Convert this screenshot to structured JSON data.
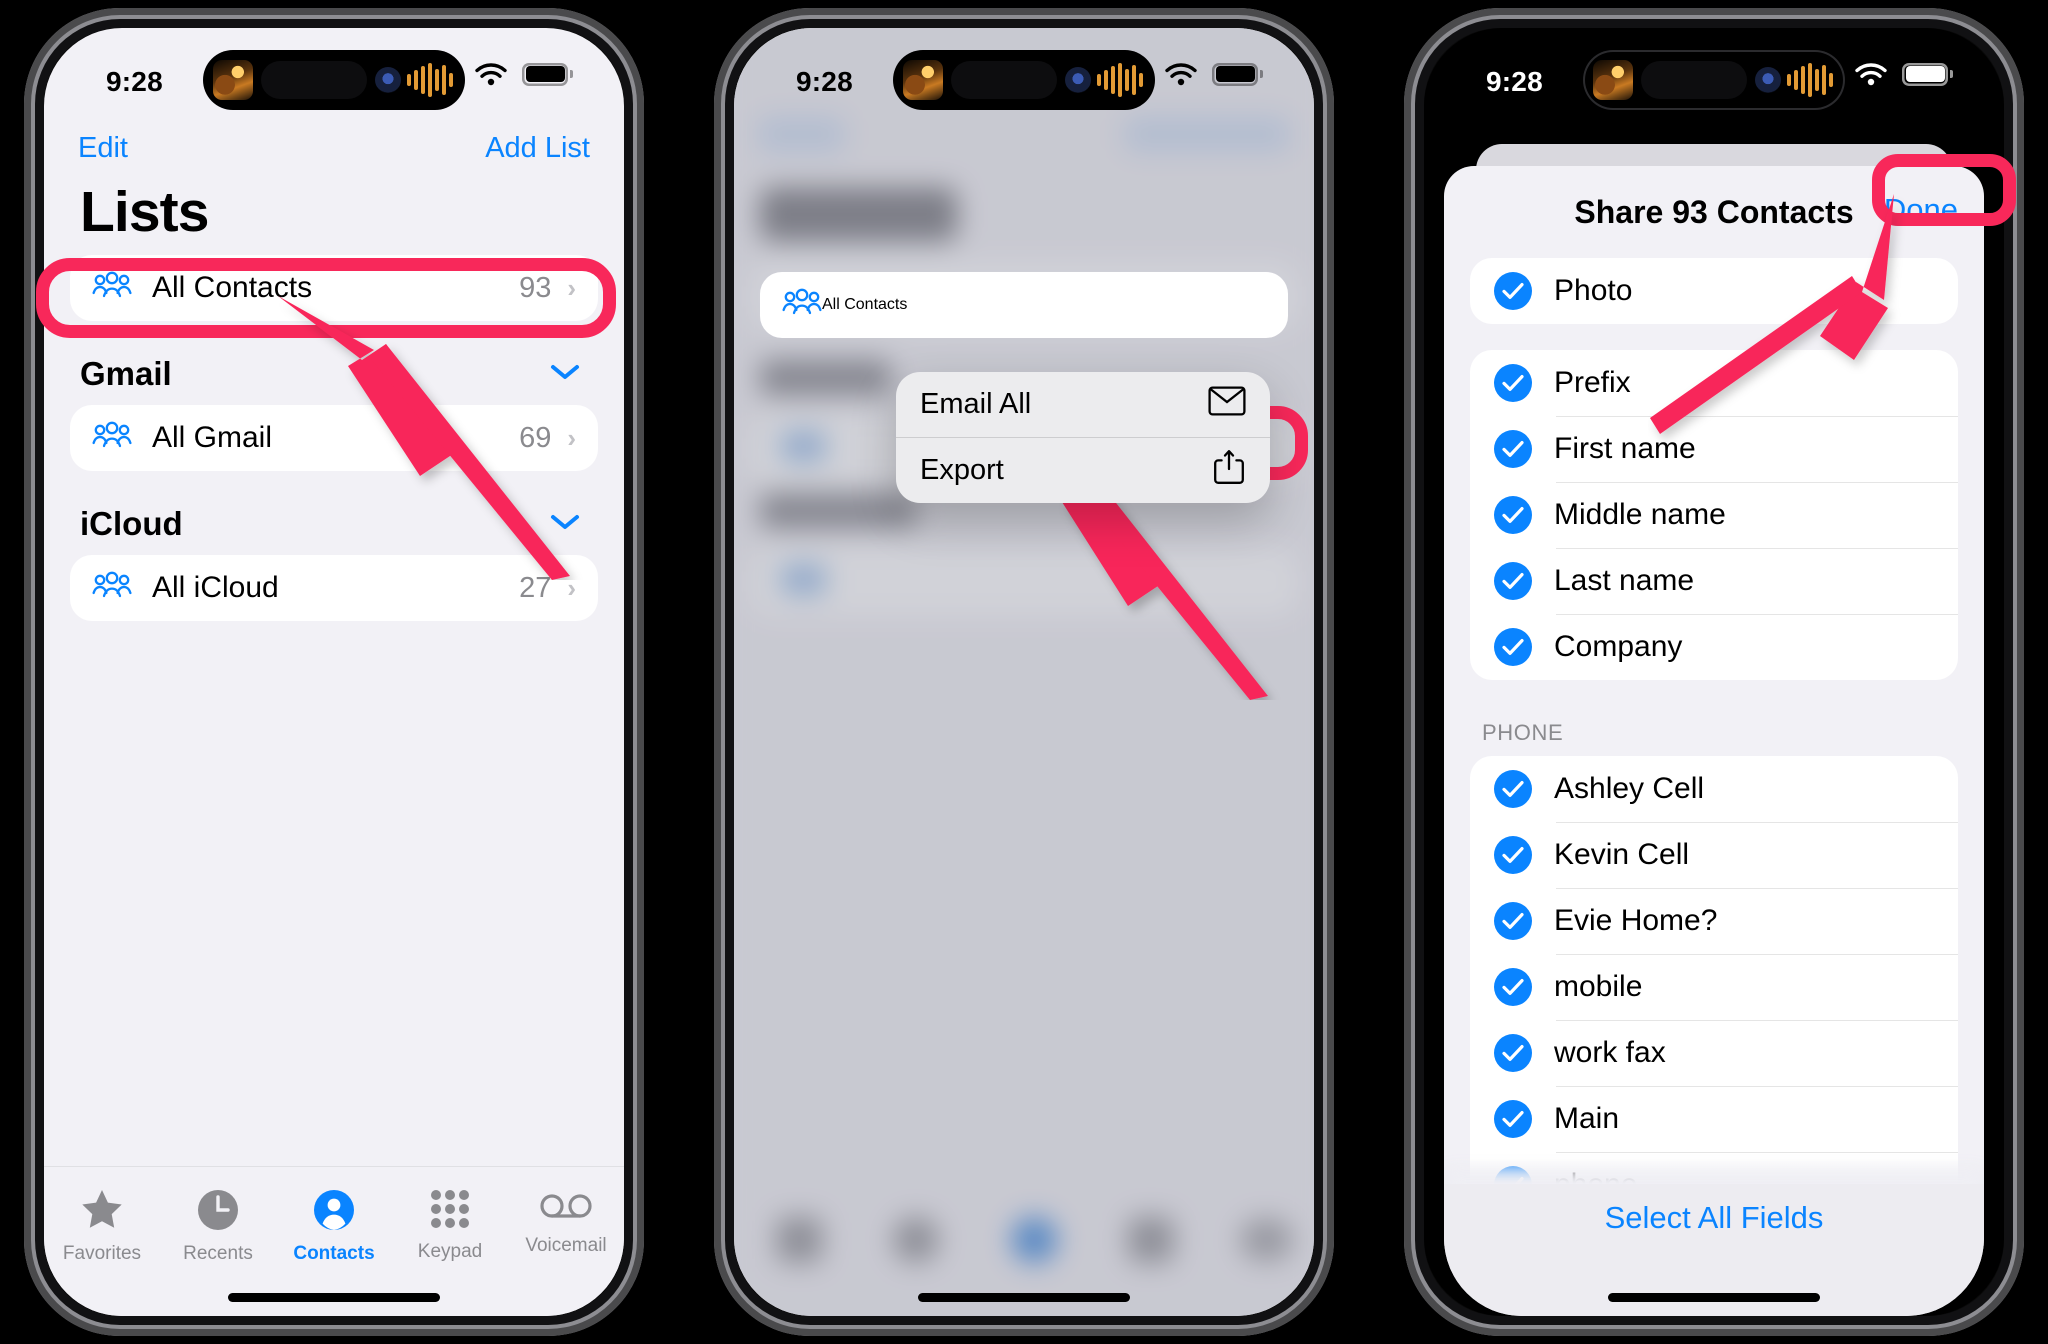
{
  "statusbar": {
    "time": "9:28",
    "wifi_icon": "wifi-icon",
    "battery_icon": "battery-icon",
    "island_icon": "dynamic-island-now-playing"
  },
  "accent": {
    "blue": "#0A84FF",
    "highlight_pink": "#F8285A",
    "gray_text": "#8A8A8E"
  },
  "phone1": {
    "nav": {
      "edit": "Edit",
      "add_list": "Add List"
    },
    "title": "Lists",
    "groups": [
      {
        "header": "",
        "rows": [
          {
            "icon": "people-icon",
            "label": "All Contacts",
            "count": "93",
            "chevron": "chevron-right-icon"
          }
        ]
      },
      {
        "header": "Gmail",
        "collapse_icon": "chevron-down-icon",
        "rows": [
          {
            "icon": "people-icon",
            "label": "All Gmail",
            "count": "69",
            "chevron": "chevron-right-icon"
          }
        ]
      },
      {
        "header": "iCloud",
        "collapse_icon": "chevron-down-icon",
        "rows": [
          {
            "icon": "people-icon",
            "label": "All iCloud",
            "count": "27",
            "chevron": "chevron-right-icon"
          }
        ]
      }
    ],
    "tabs": [
      {
        "label": "Favorites",
        "icon": "star-icon",
        "active": false
      },
      {
        "label": "Recents",
        "icon": "clock-icon",
        "active": false
      },
      {
        "label": "Contacts",
        "icon": "person-circle-icon",
        "active": true
      },
      {
        "label": "Keypad",
        "icon": "keypad-icon",
        "active": false
      },
      {
        "label": "Voicemail",
        "icon": "voicemail-icon",
        "active": false
      }
    ]
  },
  "phone2": {
    "target_row": {
      "icon": "people-icon",
      "label": "All Contacts"
    },
    "menu": [
      {
        "label": "Email All",
        "icon": "envelope-icon"
      },
      {
        "label": "Export",
        "icon": "share-icon",
        "highlighted": true
      }
    ]
  },
  "phone3": {
    "sheet_title": "Share 93 Contacts",
    "done": "Done",
    "groups": [
      {
        "header": "",
        "fields": [
          {
            "label": "Photo",
            "checked": true
          }
        ]
      },
      {
        "header": "",
        "fields": [
          {
            "label": "Prefix",
            "checked": true
          },
          {
            "label": "First name",
            "checked": true
          },
          {
            "label": "Middle name",
            "checked": true
          },
          {
            "label": "Last name",
            "checked": true
          },
          {
            "label": "Company",
            "checked": true
          }
        ]
      },
      {
        "header": "PHONE",
        "fields": [
          {
            "label": "Ashley Cell",
            "checked": true
          },
          {
            "label": "Kevin Cell",
            "checked": true
          },
          {
            "label": "Evie Home?",
            "checked": true
          },
          {
            "label": "mobile",
            "checked": true
          },
          {
            "label": "work fax",
            "checked": true
          },
          {
            "label": "Main",
            "checked": true
          },
          {
            "label": "phone",
            "checked": true
          }
        ]
      }
    ],
    "select_all": "Select All Fields"
  }
}
